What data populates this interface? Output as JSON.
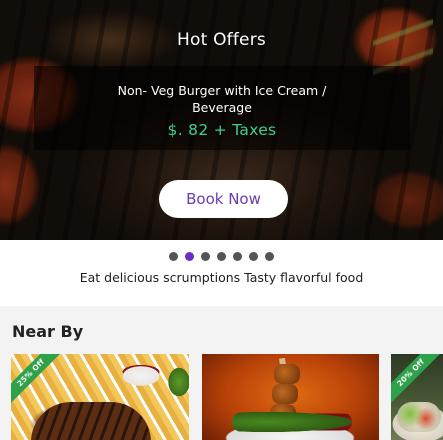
{
  "hero": {
    "title": "Hot Offers",
    "offer_name": "Non- Veg Burger with Ice Cream / Beverage",
    "offer_price": "$. 82 + Taxes",
    "book_label": "Book Now",
    "price_color": "#3fd08f",
    "button_text_color": "#6a3cb0"
  },
  "carousel": {
    "slide_count": 7,
    "active_index": 1,
    "active_color": "#6a2fc2"
  },
  "promo": {
    "tagline": "Eat delicious scrumptions Tasty flavorful food"
  },
  "nearby": {
    "title": "Near By",
    "cards": [
      {
        "badge": "25% Off",
        "badge_color": "#2da24a"
      },
      {
        "badge": ""
      },
      {
        "badge": "20% Off",
        "badge_color": "#2da24a"
      }
    ]
  }
}
